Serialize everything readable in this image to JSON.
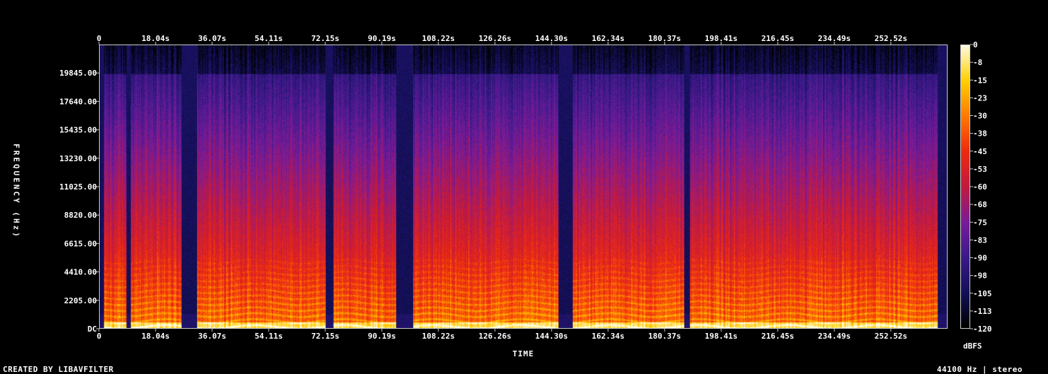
{
  "chart_data": {
    "type": "heatmap",
    "title": "",
    "xlabel": "TIME",
    "ylabel": "FREQUENCY (Hz)",
    "x_ticks": [
      "0",
      "18.04s",
      "36.07s",
      "54.11s",
      "72.15s",
      "90.19s",
      "108.22s",
      "126.26s",
      "144.30s",
      "162.34s",
      "180.37s",
      "198.41s",
      "216.45s",
      "234.49s",
      "252.52s"
    ],
    "y_ticks": [
      "DC",
      "2205.00",
      "4410.00",
      "6615.00",
      "8820.00",
      "11025.00",
      "13230.00",
      "15435.00",
      "17640.00",
      "19845.00"
    ],
    "xlim": [
      0,
      270.6
    ],
    "ylim": [
      0,
      22050
    ],
    "colorbar": {
      "label": "dBFS",
      "ticks": [
        "0",
        "-8",
        "-15",
        "-23",
        "-30",
        "-38",
        "-45",
        "-53",
        "-60",
        "-68",
        "-75",
        "-83",
        "-90",
        "-98",
        "-105",
        "-113",
        "-120"
      ],
      "range": [
        -120,
        0
      ],
      "colors": [
        "#000000",
        "#14105a",
        "#3a1a8a",
        "#7a1a9a",
        "#c21a40",
        "#ee2a10",
        "#ff7a00",
        "#ffd000",
        "#fffbe0"
      ]
    },
    "quiet_segments_s": [
      [
        0,
        1.2
      ],
      [
        8.5,
        9.8
      ],
      [
        26,
        31
      ],
      [
        72.0,
        74.5
      ],
      [
        94.5,
        100.0
      ],
      [
        146.5,
        151.0
      ],
      [
        186.5,
        188.5
      ],
      [
        267.5,
        270.6
      ]
    ],
    "grid": false
  },
  "footer": {
    "left": "CREATED BY LIBAVFILTER",
    "right": "44100 Hz | stereo"
  }
}
